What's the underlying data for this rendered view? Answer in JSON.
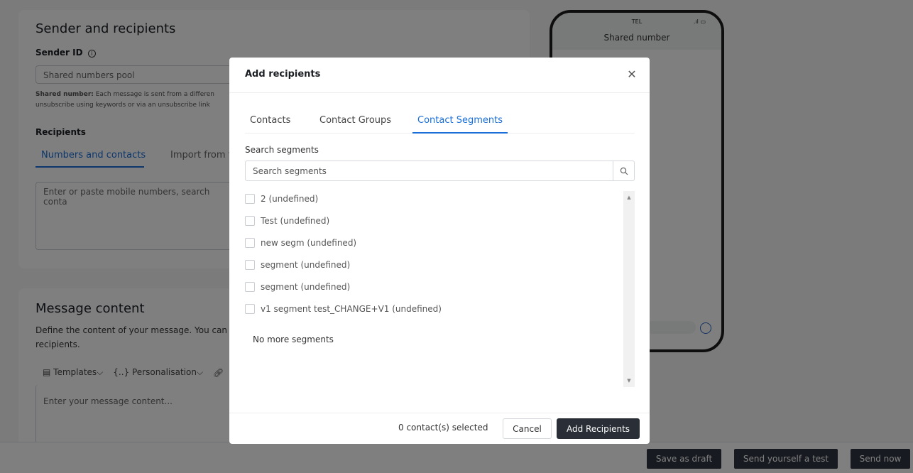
{
  "background": {
    "sender_section": {
      "title": "Sender and recipients",
      "sender_id_label": "Sender ID",
      "sender_id_value": "Shared numbers pool",
      "shared_note_bold": "Shared number:",
      "shared_note_text": "Each message is sent from a differen",
      "shared_note_line2": "unsubscribe using keywords or via an unsubscribe link",
      "recipients_label": "Recipients",
      "tabs": [
        "Numbers and contacts",
        "Import from fi"
      ],
      "recipients_placeholder": "Enter or paste mobile numbers, search conta"
    },
    "message_section": {
      "title": "Message content",
      "description_line1": "Define the content of your message. You can u",
      "description_line2": "recipients.",
      "toolbar": [
        "Templates",
        "Personalisation"
      ],
      "placeholder": "Enter your message content..."
    },
    "phone_preview": {
      "carrier": "TEL",
      "title": "Shared number"
    },
    "footer_buttons": [
      "Save as draft",
      "Send yourself a test",
      "Send now"
    ]
  },
  "modal": {
    "title": "Add recipients",
    "tabs": [
      {
        "label": "Contacts",
        "active": false
      },
      {
        "label": "Contact Groups",
        "active": false
      },
      {
        "label": "Contact Segments",
        "active": true
      }
    ],
    "search": {
      "label": "Search segments",
      "placeholder": "Search segments"
    },
    "segments": [
      "2 (undefined)",
      "Test (undefined)",
      "new segm (undefined)",
      "segment (undefined)",
      "segment (undefined)",
      "v1 segment test_CHANGE+V1 (undefined)"
    ],
    "no_more_text": "No more segments",
    "selected_count": "0 contact(s) selected",
    "cancel_label": "Cancel",
    "add_label": "Add Recipients"
  },
  "colors": {
    "accent": "#1a6ed8",
    "primary_button": "#2a2f37",
    "overlay": "rgba(0,0,0,0.5)"
  }
}
